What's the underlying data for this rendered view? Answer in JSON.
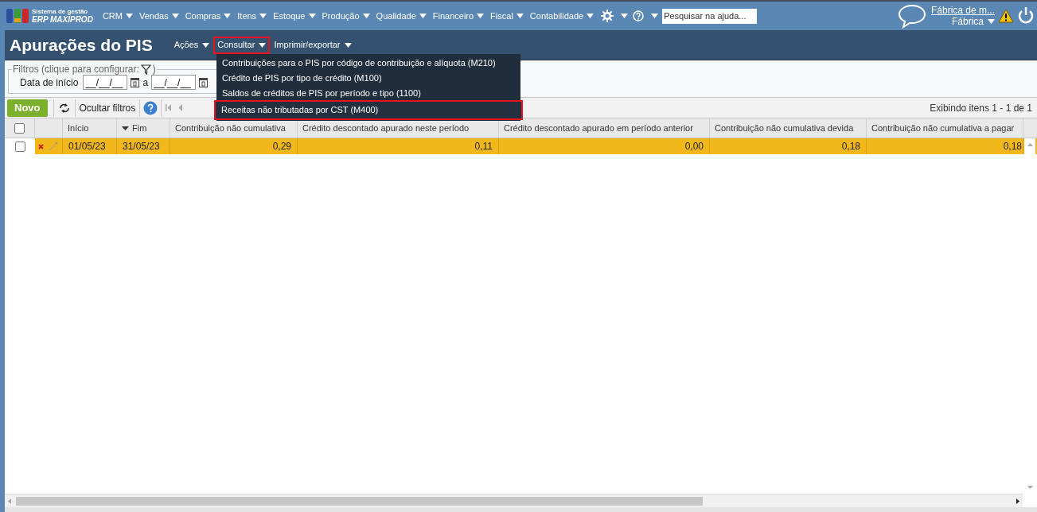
{
  "app": {
    "logo_line1": "Sistema de gestão",
    "logo_line2": "ERP MAXIPROD"
  },
  "nav_menu": [
    {
      "label": "CRM"
    },
    {
      "label": "Vendas"
    },
    {
      "label": "Compras"
    },
    {
      "label": "Itens"
    },
    {
      "label": "Estoque"
    },
    {
      "label": "Produção"
    },
    {
      "label": "Qualidade"
    },
    {
      "label": "Financeiro"
    },
    {
      "label": "Fiscal"
    },
    {
      "label": "Contabilidade"
    }
  ],
  "help_search": {
    "placeholder": "Pesquisar na ajuda..."
  },
  "user": {
    "company_link": "Fábrica de m...",
    "profile": "Fábrica"
  },
  "page_title": "Apurações do PIS",
  "actions_menu": [
    {
      "label": "Ações",
      "highlighted": false
    },
    {
      "label": "Consultar",
      "highlighted": true
    },
    {
      "label": "Imprimir/exportar",
      "highlighted": false
    }
  ],
  "consultar_dropdown": [
    {
      "label": "Contribuições para o PIS por código de contribuição e alíquota (M210)",
      "highlighted": false
    },
    {
      "label": "Crédito de PIS por tipo de crédito (M100)",
      "highlighted": false
    },
    {
      "label": "Saldos de créditos de PIS por período e tipo (1100)",
      "highlighted": false
    },
    {
      "label": "Receitas não tributadas por CST (M400)",
      "highlighted": true
    }
  ],
  "filters": {
    "legend": "Filtros (clique para configurar:",
    "legend_end": ")",
    "date_label": "Data de início",
    "from_value": "__/__/__",
    "separator": "a",
    "to_value": "__/__/__"
  },
  "toolbar": {
    "new_button": "Novo",
    "hide_filters": "Ocultar filtros",
    "page_info": "Exibindo itens 1 - 1 de 1"
  },
  "table": {
    "select_all_checked": false,
    "columns": [
      {
        "label": "Início",
        "kind": "date",
        "sorted": false
      },
      {
        "label": "Fim",
        "kind": "date",
        "sorted": true
      },
      {
        "label": "Contribuição não cumulativa",
        "kind": "number",
        "sorted": false
      },
      {
        "label": "Crédito descontado apurado neste período",
        "kind": "number",
        "sorted": false
      },
      {
        "label": "Crédito descontado apurado em período anterior",
        "kind": "number",
        "sorted": false
      },
      {
        "label": "Contribuição não cumulativa devida",
        "kind": "number",
        "sorted": false
      },
      {
        "label": "Contribuição não cumulativa a pagar",
        "kind": "number",
        "sorted": false
      }
    ],
    "rows": [
      {
        "selected": true,
        "checked": false,
        "cells": [
          "01/05/23",
          "31/05/23",
          "0,29",
          "0,11",
          "0,00",
          "0,18",
          "0,18"
        ]
      }
    ]
  }
}
